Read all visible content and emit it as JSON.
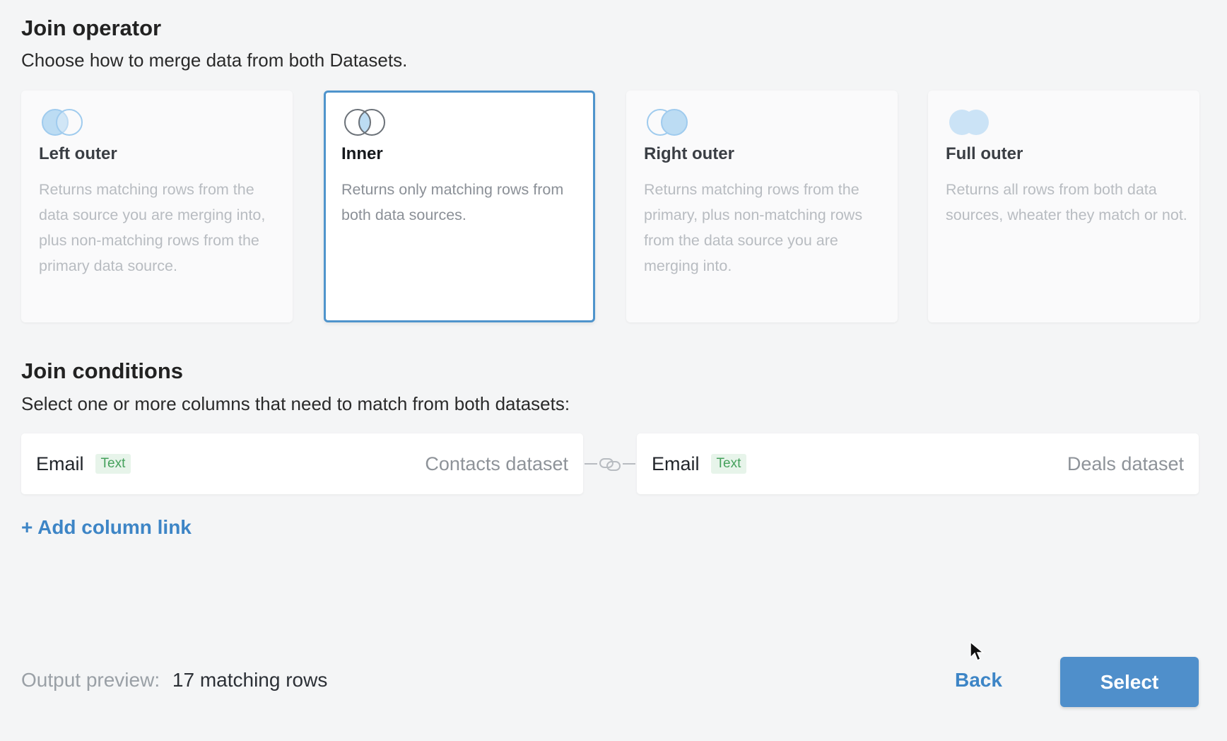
{
  "join_operator": {
    "title": "Join operator",
    "subtitle": "Choose how to merge data from both Datasets.",
    "selected": "Inner",
    "options": [
      {
        "label": "Left outer",
        "icon": "venn-left-outer-icon",
        "description": "Returns matching rows from the data source you are merging into, plus non-matching rows from the primary data source."
      },
      {
        "label": "Inner",
        "icon": "venn-inner-icon",
        "description": "Returns only matching rows from both data sources."
      },
      {
        "label": "Right outer",
        "icon": "venn-right-outer-icon",
        "description": "Returns matching rows from the primary, plus non-matching rows from the data source you are merging into."
      },
      {
        "label": "Full outer",
        "icon": "venn-full-outer-icon",
        "description": "Returns all rows from both data sources, wheater they match or not."
      }
    ]
  },
  "join_conditions": {
    "title": "Join conditions",
    "subtitle": "Select one or more columns that need to match from both datasets:",
    "links": [
      {
        "left": {
          "column": "Email",
          "type": "Text",
          "dataset": "Contacts dataset"
        },
        "right": {
          "column": "Email",
          "type": "Text",
          "dataset": "Deals dataset"
        },
        "connector_icon": "link-icon"
      }
    ],
    "add_link_label": "+ Add column link"
  },
  "footer": {
    "preview_label": "Output preview:",
    "preview_value": "17 matching rows",
    "back_label": "Back",
    "select_label": "Select"
  },
  "colors": {
    "accent": "#4f8fcb",
    "link": "#3d85c6",
    "selected_border": "#4f94cc",
    "tag_bg": "#e7f4ea",
    "tag_text": "#45a15c",
    "venn_fill": "#bcdcf3"
  }
}
